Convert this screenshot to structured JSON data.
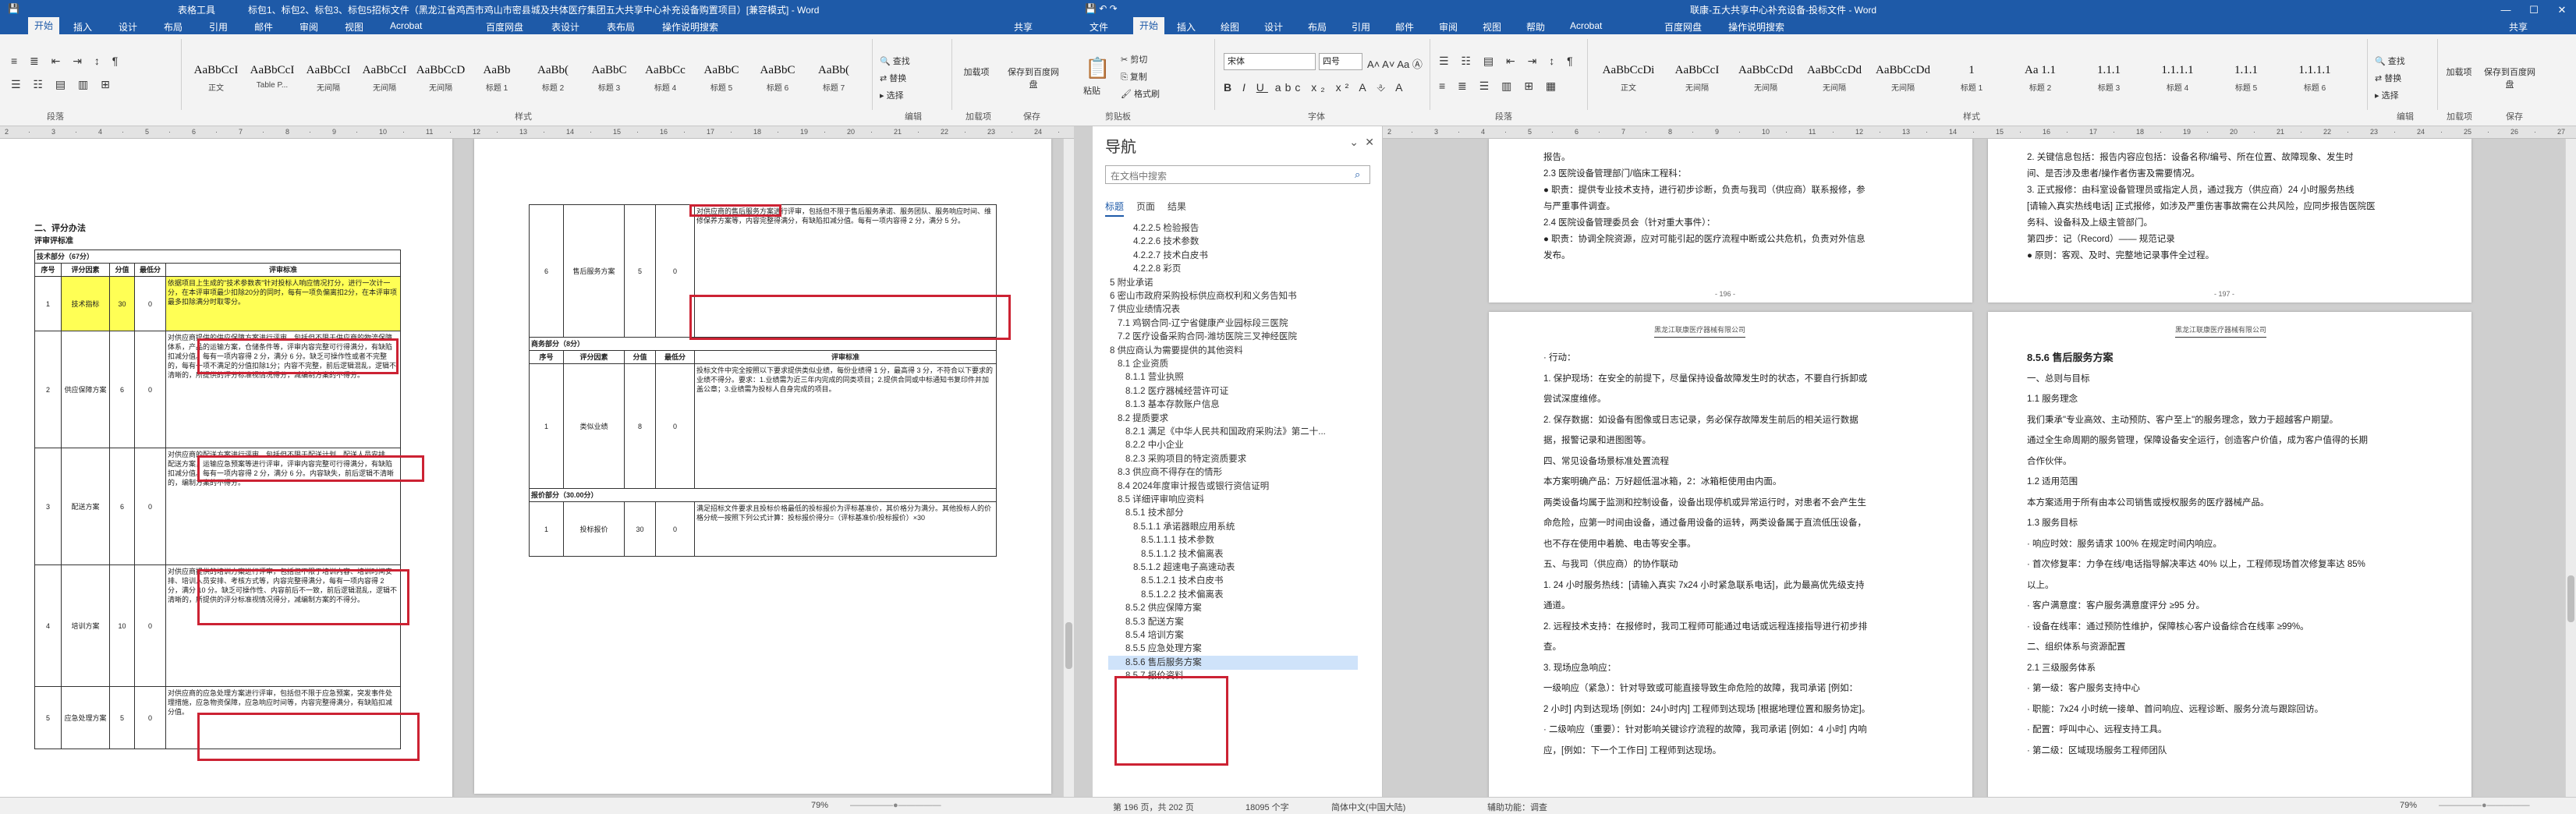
{
  "left_window": {
    "title_segments": [
      "表格工具",
      "标包1、标包2、标包3、标包5招标文件（黑龙江省鸡西市鸡山市密县城及共体医疗集团五大共享中心补充设备购置项目）[兼容模式] - Word"
    ],
    "ribbon_tabs": [
      "开始",
      "插入",
      "设计",
      "布局",
      "引用",
      "邮件",
      "审阅",
      "视图",
      "Acrobat",
      "百度网盘",
      "表设计",
      "表布局",
      "操作说明搜索"
    ],
    "share": "共享",
    "styles": [
      {
        "preview": "AaBbCcI",
        "name": "正文"
      },
      {
        "preview": "AaBbCcI",
        "name": "Table P..."
      },
      {
        "preview": "AaBbCcI",
        "name": "无间隔"
      },
      {
        "preview": "AaBbCcI",
        "name": "无间隔"
      },
      {
        "preview": "AaBbCcD",
        "name": "无间隔"
      },
      {
        "preview": "AaBb",
        "name": "标题 1"
      },
      {
        "preview": "AaBb(",
        "name": "标题 2"
      },
      {
        "preview": "AaBbC",
        "name": "标题 3"
      },
      {
        "preview": "AaBbCc",
        "name": "标题 4"
      },
      {
        "preview": "AaBbC",
        "name": "标题 5"
      },
      {
        "preview": "AaBbC",
        "name": "标题 6"
      },
      {
        "preview": "AaBb(",
        "name": "标题 7"
      }
    ],
    "edit": {
      "find": "查找",
      "replace": "替换",
      "select": "选择"
    },
    "side_buttons": [
      "加载项",
      "保存到百度网盘"
    ],
    "group_labels": [
      "段落",
      "样式",
      "编辑",
      "加载项",
      "保存"
    ],
    "page1": {
      "heading": "二、评分办法",
      "subheading": "评审评标准",
      "section": "技术部分（67分）",
      "header": [
        "序号",
        "评分因素",
        "分值",
        "最低分",
        "评审标准"
      ],
      "rows": [
        {
          "no": "1",
          "factor": "技术指标",
          "score": "30",
          "min": "0",
          "text": "依据项目上生成的\"技术参数表\"针对投标人响应情况打分，进行一次计一分，在本评审项最少扣除20分的同时，每有一项负偏离扣2分，在本评审项最多扣除满分时取零分。"
        },
        {
          "no": "2",
          "factor": "供应保障方案",
          "score": "6",
          "min": "0",
          "text": "对供应商提供的供应保障方案进行评审，包括但不限于供应商的物流保障体系，产品的运输方案，仓储条件等，评审内容完整可行得满分，有缺陷扣减分值。每有一项内容得 2 分，满分 6 分。缺乏可操作性或者不完整的，每有一项不满足的分值扣除1分；内容不完整，前后逻辑混乱，逻辑不清晰的，所提供的评分标准视情况得分，减编制方案的不得分。"
        },
        {
          "no": "3",
          "factor": "配送方案",
          "score": "6",
          "min": "0",
          "text": "对供应商的配送方案进行评审，包括但不限于配送计划、配送人员安排、配送方案，运输应急预案等进行评审，评审内容完整可行得满分，有缺陷扣减分值。每有一项内容得 2 分，满分 6 分。内容缺失，前后逻辑不清晰的，编制方案的不得分。"
        },
        {
          "no": "4",
          "factor": "培训方案",
          "score": "10",
          "min": "0",
          "text": "对供应商提供的培训方案进行评审，包括但不限于培训内容、培训时间安排、培训人员安排、考核方式等，内容完整得满分，每有一项内容得 2 分，满分 10 分。缺乏可操作性、内容前后不一致，前后逻辑混乱，逻辑不清晰的，所提供的评分标准视情况得分，减编制方案的不得分。"
        },
        {
          "no": "5",
          "factor": "应急处理方案",
          "score": "5",
          "min": "0",
          "text": "对供应商的应急处理方案进行评审，包括但不限于应急预案，突发事件处理措施，应急物资保障，应急响应时间等，内容完整得满分，有缺陷扣减分值。"
        }
      ]
    },
    "page2": {
      "rows_top": [
        {
          "no": "6",
          "factor": "售后服务方案",
          "score": "5",
          "min": "0",
          "text": "对供应商的售后服务方案进行评审，包括但不限于售后服务承诺、服务团队、服务响应时间、维修保养方案等，内容完整得满分，有缺陷扣减分值。每有一项内容得 2 分，满分 5 分。"
        }
      ],
      "business_section": "商务部分（8分）",
      "business_header": [
        "序号",
        "评分因素",
        "分值",
        "最低分",
        "评审标准"
      ],
      "business_row": {
        "no": "1",
        "factor": "类似业绩",
        "score": "8",
        "min": "0",
        "text": "投标文件中完全按照以下要求提供类似业绩，每份业绩得 1 分，最高得 3 分，不符合以下要求的业绩不得分。要求：1.业绩需为近三年内完成的同类项目；2.提供合同或中标通知书复印件并加盖公章；3.业绩需为投标人自身完成的项目。"
      },
      "price_section": "报价部分（30.00分）",
      "price_row": {
        "no": "1",
        "factor": "投标报价",
        "score": "30",
        "min": "0",
        "text": "满足招标文件要求且投标价格最低的投标报价为评标基准价，其价格分为满分。其他投标人的价格分统一按照下列公式计算：投标报价得分=（评标基准价/投标报价）×30"
      }
    },
    "status": [
      "第 196 页，共 202 页",
      "18095 个字",
      "简体中文(中国大陆)",
      "辅助功能：调查",
      "79%"
    ]
  },
  "right_window": {
    "title": "联康-五大共享中心补充设备-投标文件 - Word",
    "ribbon_tabs": [
      "文件",
      "开始",
      "插入",
      "绘图",
      "设计",
      "布局",
      "引用",
      "邮件",
      "审阅",
      "视图",
      "帮助",
      "Acrobat",
      "百度网盘",
      "操作说明搜索"
    ],
    "share": "共享",
    "clipboard": {
      "paste": "粘贴",
      "cut": "剪切",
      "copy": "复制",
      "format": "格式刷"
    },
    "font_name": "宋体",
    "font_size": "四号",
    "group_labels": [
      "剪贴板",
      "字体",
      "段落",
      "样式",
      "编辑",
      "加载项",
      "保存"
    ],
    "side_buttons": [
      "加载项",
      "保存到百度网盘"
    ],
    "styles": [
      {
        "preview": "AaBbCcDi",
        "name": "正文"
      },
      {
        "preview": "AaBbCcI",
        "name": "无间隔"
      },
      {
        "preview": "AaBbCcDd",
        "name": "无间隔"
      },
      {
        "preview": "AaBbCcDd",
        "name": "无间隔"
      },
      {
        "preview": "AaBbCcDd",
        "name": "无间隔"
      },
      {
        "preview": "1",
        "name": "标题 1"
      },
      {
        "preview": "Aa 1.1",
        "name": "标题 2"
      },
      {
        "preview": "1.1.1",
        "name": "标题 3"
      },
      {
        "preview": "1.1.1.1",
        "name": "标题 4"
      },
      {
        "preview": "1.1.1",
        "name": "标题 5"
      },
      {
        "preview": "1.1.1.1",
        "name": "标题 6"
      }
    ],
    "edit": {
      "find": "查找",
      "replace": "替换",
      "select": "选择"
    },
    "status": [
      "第 196 页，共 202 页",
      "18095 个字",
      "简体中文(中国大陆)",
      "辅助功能：调查",
      "79%"
    ],
    "page_header": "黑龙江联康医疗器械有限公司",
    "page_a_top": [
      "报告。",
      "2.3 医院设备管理部门/临床工程科：",
      "● 职责：提供专业技术支持，进行初步诊断，负责与我司（供应商）联系报修，参",
      "与严重事件调查。",
      "2.4 医院设备管理委员会（针对重大事件）：",
      "● 职责：协调全院资源，应对可能引起的医疗流程中断或公共危机，负责对外信息",
      "发布。"
    ],
    "page_b_top": [
      "2. 关键信息包括：报告内容应包括：设备名称/编号、所在位置、故障现象、发生时",
      "间、是否涉及患者/操作者伤害及需要情况。",
      "3. 正式报修：由科室设备管理员或指定人员，通过我方（供应商）24 小时服务热线",
      "[请输入真实热线电话] 正式报修，如涉及严重伤害事故需在公共风险，应同步报告医院医",
      "务科、设备科及上级主管部门。",
      "第四步：记（Record）—— 规范记录",
      "● 原则：客观、及时、完整地记录事件全过程。"
    ],
    "page_a_bottom": [
      "· 行动：",
      "1. 保护现场：在安全的前提下，尽量保持设备故障发生时的状态，不要自行拆卸或",
      "尝试深度维修。",
      "2. 保存数据：如设备有图像或日志记录，务必保存故障发生前后的相关运行数据",
      "据，报警记录和进图图等。",
      "四、常见设备场景标准处置流程",
      "本方案明确产品：万好超低温冰箱，2：冰箱柜使用由内面。",
      "两类设备均属于监测和控制设备，设备出现停机或异常运行时，对患者不会产生生",
      "命危险，应第一时间由设备，通过备用设备的运转，两类设备属于直流低压设备，",
      "也不存在使用中着脆、电击等安全事。",
      "五、与我司（供应商）的协作联动",
      "1. 24 小时服务热线：[请输入真实 7x24 小时紧急联系电话]，此为最高优先级支持",
      "通道。",
      "2. 远程技术支持：在报修时，我司工程师可能通过电话或远程连接指导进行初步排",
      "查。",
      "3. 现场应急响应：",
      "一级响应（紧急）：针对导致或可能直接导致生命危险的故障，我司承诺 [例如：",
      "2 小时] 内到达现场 [例如：24小时内] 工程师到达现场 [根据地理位置和服务协定]。",
      "· 二级响应（重要）：针对影响关键诊疗流程的故障，我司承诺 [例如：4 小时] 内响",
      "应，[例如：下一个工作日] 工程师到达现场。"
    ],
    "page_b_bottom": [
      "8.5.6 售后服务方案",
      "一、总则与目标",
      "1.1 服务理念",
      "我们秉承\"专业高效、主动预防、客户至上\"的服务理念，致力于超越客户期望。",
      "通过全生命周期的服务管理，保障设备安全运行，创造客户价值，成为客户值得的长期",
      "合作伙伴。",
      "1.2 适用范围",
      "本方案适用于所有由本公司销售或授权服务的医疗器械产品。",
      "1.3 服务目标",
      "· 响应时效：服务请求 100% 在规定时间内响应。",
      "· 首次修复率：力争在线/电话指导解决率达 40% 以上，工程师现场首次修复率达 85%",
      "以上。",
      "· 客户满意度：客户服务满意度评分 ≥95 分。",
      "· 设备在线率：通过预防性维护，保障核心客户设备综合在线率 ≥99%。",
      "二、组织体系与资源配置",
      "2.1 三级服务体系",
      "· 第一级：客户服务支持中心",
      "· 职能：7x24 小时统一接单、首问响应、远程诊断、服务分流与跟踪回访。",
      "· 配置：呼叫中心、远程支持工具。",
      "· 第二级：区域现场服务工程师团队"
    ],
    "page_num_a": "- 196 -",
    "page_num_b": "- 197 -"
  },
  "navigation": {
    "title": "导航",
    "search_placeholder": "在文档中搜索",
    "tabs": [
      "标题",
      "页面",
      "结果"
    ],
    "items": [
      {
        "label": "4.2.2.5 检验报告",
        "level": 4
      },
      {
        "label": "4.2.2.6 技术参数",
        "level": 4
      },
      {
        "label": "4.2.2.7 技术白皮书",
        "level": 4
      },
      {
        "label": "4.2.2.8 彩页",
        "level": 4
      },
      {
        "label": "5 附业承诺",
        "level": 1
      },
      {
        "label": "6 密山市政府采购投标供应商权利和义务告知书",
        "level": 1
      },
      {
        "label": "7 供应业绩情况表",
        "level": 1
      },
      {
        "label": "7.1 鸡钢合同-辽宁省健康产业园标段三医院",
        "level": 2
      },
      {
        "label": "7.2 医疗设备采购合同-潍坊医院三叉神经医院",
        "level": 2
      },
      {
        "label": "8 供应商认为需要提供的其他资料",
        "level": 1
      },
      {
        "label": "8.1 企业资质",
        "level": 2
      },
      {
        "label": "8.1.1 营业执照",
        "level": 3
      },
      {
        "label": "8.1.2 医疗器械经营许可证",
        "level": 3
      },
      {
        "label": "8.1.3 基本存款账户信息",
        "level": 3
      },
      {
        "label": "8.2 提质要求",
        "level": 2
      },
      {
        "label": "8.2.1 满足《中华人民共和国政府采购法》第二十...",
        "level": 3
      },
      {
        "label": "8.2.2 中小企业",
        "level": 3
      },
      {
        "label": "8.2.3 采购项目的特定资质要求",
        "level": 3
      },
      {
        "label": "8.3 供应商不得存在的情形",
        "level": 2
      },
      {
        "label": "8.4 2024年度审计报告或银行资信证明",
        "level": 2
      },
      {
        "label": "8.5 详细评审响应资料",
        "level": 2
      },
      {
        "label": "8.5.1 技术部分",
        "level": 3
      },
      {
        "label": "8.5.1.1 承诺器眼应用系统",
        "level": 4
      },
      {
        "label": "8.5.1.1.1 技术参数",
        "level": 5
      },
      {
        "label": "8.5.1.1.2 技术偏离表",
        "level": 5
      },
      {
        "label": "8.5.1.2 超速电子高速动表",
        "level": 4
      },
      {
        "label": "8.5.1.2.1 技术白皮书",
        "level": 5
      },
      {
        "label": "8.5.1.2.2 技术偏离表",
        "level": 5
      },
      {
        "label": "8.5.2 供应保障方案",
        "level": 3
      },
      {
        "label": "8.5.3 配送方案",
        "level": 3
      },
      {
        "label": "8.5.4 培训方案",
        "level": 3
      },
      {
        "label": "8.5.5 应急处理方案",
        "level": 3
      },
      {
        "label": "8.5.6 售后服务方案",
        "level": 3
      },
      {
        "label": "8.5.7 报价资料",
        "level": 3
      }
    ],
    "selected_index": 32
  },
  "colors": {
    "titlebar": "#1e5aa8",
    "highlight_box": "#cc2233",
    "nav_selected": "#cfe3fa",
    "text_highlight": "#ffff55"
  }
}
